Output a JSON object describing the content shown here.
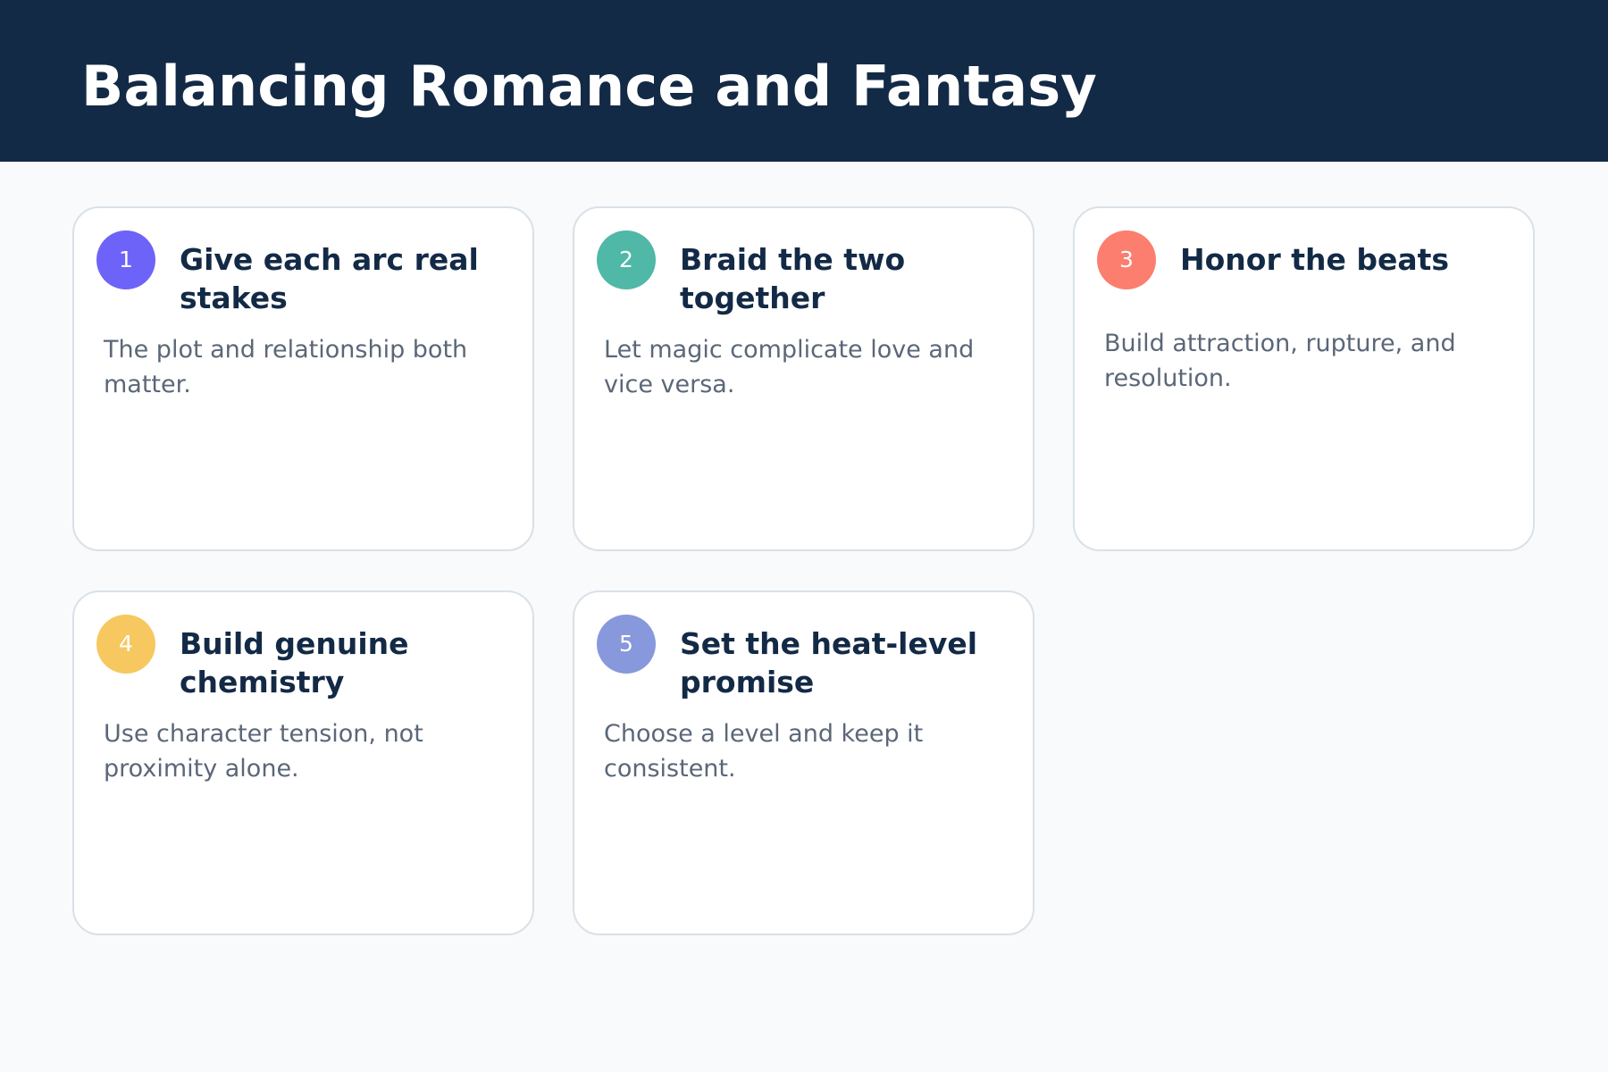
{
  "title": "Balancing Romance and Fantasy",
  "cards": [
    {
      "number": "1",
      "title": "Give each arc real stakes",
      "description": "The plot and relationship both matter.",
      "color": "#6e63f8"
    },
    {
      "number": "2",
      "title": "Braid the two together",
      "description": "Let magic complicate love and vice versa.",
      "color": "#4fb8a7"
    },
    {
      "number": "3",
      "title": "Honor the beats",
      "description": "Build attraction, rupture, and resolution.",
      "color": "#fb7e6e"
    },
    {
      "number": "4",
      "title": "Build genuine chemistry",
      "description": "Use character tension, not proximity alone.",
      "color": "#f6c85f"
    },
    {
      "number": "5",
      "title": "Set the heat-level promise",
      "description": "Choose a level and keep it consistent.",
      "color": "#8799dc"
    }
  ]
}
